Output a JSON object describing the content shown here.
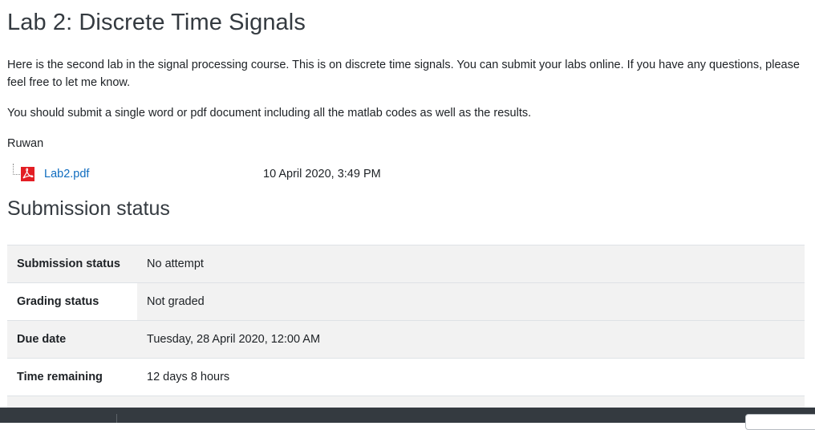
{
  "assignment": {
    "title": "Lab 2: Discrete Time Signals",
    "intro": "Here is the second lab in the signal processing course. This is on discrete time signals. You can submit your labs online. If you have any questions, please feel free to let me know.",
    "instruction": "You should submit a single word or pdf document including all the matlab codes as well as the results.",
    "signature": "Ruwan",
    "attachment": {
      "icon": "pdf-icon",
      "name": "Lab2.pdf",
      "date": "10 April 2020, 3:49 PM"
    }
  },
  "submission": {
    "title": "Submission status",
    "rows": [
      {
        "label": "Submission status",
        "value": "No attempt"
      },
      {
        "label": "Grading status",
        "value": "Not graded"
      },
      {
        "label": "Due date",
        "value": "Tuesday, 28 April 2020, 12:00 AM"
      },
      {
        "label": "Time remaining",
        "value": "12 days 8 hours"
      }
    ]
  },
  "colors": {
    "link": "#0f6cbf",
    "pdf_red": "#e31e24",
    "footer": "#343a40"
  }
}
